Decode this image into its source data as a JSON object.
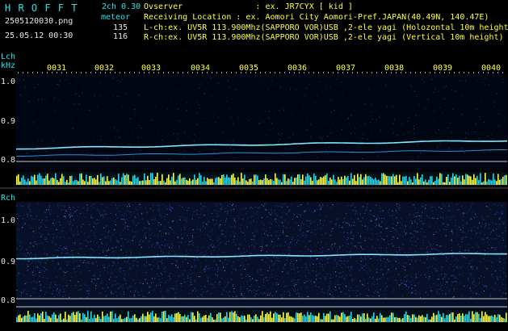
{
  "header": {
    "app_title": "H R O F F T",
    "version": "2ch 0.30",
    "filename": "2505120030.png",
    "datetime": "25.05.12 00:30",
    "meteor_label": "meteor",
    "count_l": "135",
    "count_r": "116",
    "observer": "Ovserver               : ex. JR7CYX [ kid ]",
    "location": "Receiving Location : ex. Aomori City Aomori-Pref.JAPAN(40.49N, 140.47E)",
    "lch_info": "L-ch:ex. UV5R 113.900Mhz(SAPPORO VOR)USB ,2-ele yagi (Holozontal 10m height)",
    "rch_info": "R-ch:ex. UV5R 113.900Mhz(SAPPORO VOR)USB ,2-ele yagi (Vertical 10m height)"
  },
  "time_ticks": [
    "0031",
    "0032",
    "0033",
    "0034",
    "0035",
    "0036",
    "0037",
    "0038",
    "0039",
    "0040"
  ],
  "lch": {
    "label": "Lch",
    "unit": "kHz",
    "axis": [
      "1.0",
      "0.9",
      "0.8"
    ]
  },
  "rch": {
    "label": "Rch",
    "axis": [
      "1.0",
      "0.9",
      "0.8"
    ]
  },
  "colors": {
    "text_cyan": "#22e6e6",
    "text_white": "#e8e8e8",
    "text_yellow": "#ffff3c",
    "panel_bg": "#000814",
    "signal": "#7fe8ff",
    "bar_yellow": "#ffff3c",
    "bar_cyan": "#22d8e8"
  }
}
